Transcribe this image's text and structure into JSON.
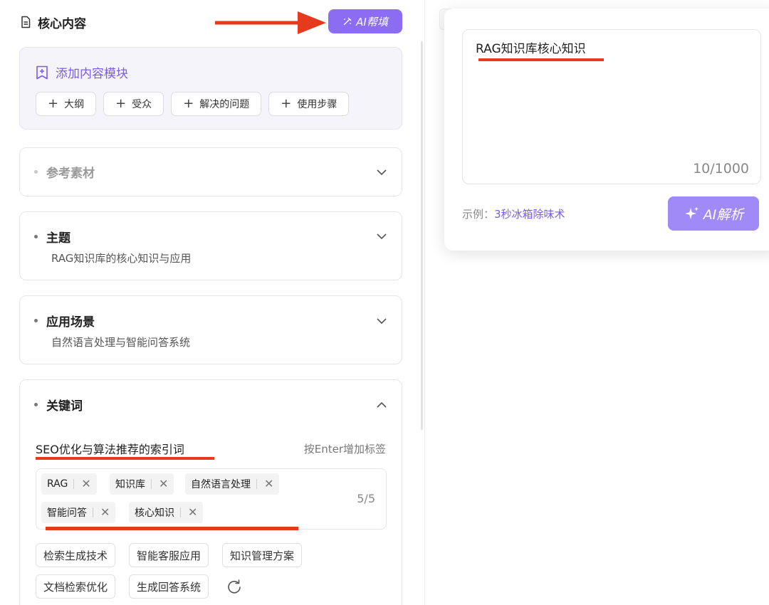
{
  "header": {
    "title": "核心内容",
    "ai_fill_label": "AI帮填"
  },
  "add_module": {
    "title": "添加内容模块",
    "chips": [
      {
        "label": "大纲"
      },
      {
        "label": "受众"
      },
      {
        "label": "解决的问题"
      },
      {
        "label": "使用步骤"
      }
    ]
  },
  "sections": {
    "reference": {
      "title": "参考素材"
    },
    "topic": {
      "title": "主题",
      "value": "RAG知识库的核心知识与应用"
    },
    "scenario": {
      "title": "应用场景",
      "value": "自然语言处理与智能问答系统"
    },
    "keywords": {
      "title": "关键词",
      "heading": "SEO优化与算法推荐的索引词",
      "hint": "按Enter增加标签",
      "count": "5/5",
      "tags": [
        "RAG",
        "知识库",
        "自然语言处理",
        "智能问答",
        "核心知识"
      ],
      "suggestions": [
        "检索生成技术",
        "智能客服应用",
        "知识管理方案",
        "文档检索优化",
        "生成回答系统"
      ]
    }
  },
  "popover": {
    "input_value": "RAG知识库核心知识",
    "char_count": "10/1000",
    "example_prefix": "示例：",
    "example_link": "3秒冰箱除味术",
    "parse_label": "AI解析"
  },
  "colors": {
    "accent": "#8b6cf2",
    "annotation_red": "#e63a1f"
  }
}
